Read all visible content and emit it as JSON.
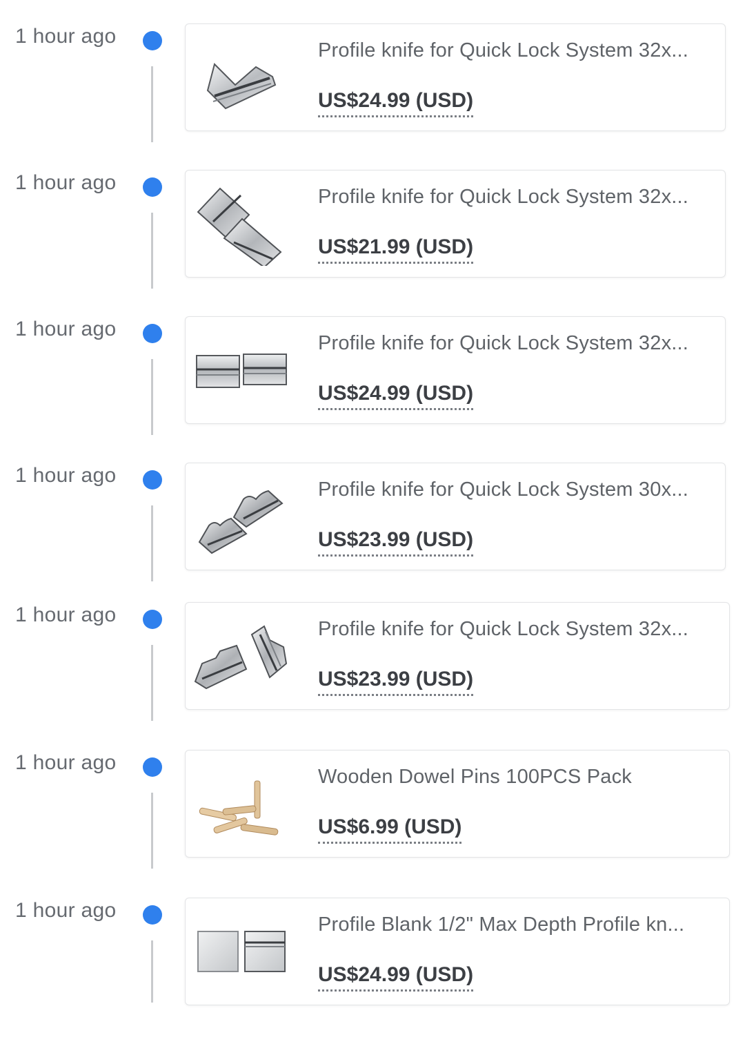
{
  "colors": {
    "accent_dot": "#2f80ed",
    "timeline_line": "#c8cacd",
    "card_border": "#e3e4e6",
    "muted_text": "#666a70",
    "price_text": "#3c3f44"
  },
  "items": [
    {
      "time": "1 hour ago",
      "title": "Profile knife for Quick Lock System 32x...",
      "price": "US$24.99 (USD)",
      "icon": "profile-knife-single-icon"
    },
    {
      "time": "1 hour ago",
      "title": "Profile knife for Quick Lock System 32x...",
      "price": "US$21.99 (USD)",
      "icon": "profile-knife-pair-diagonal-icon"
    },
    {
      "time": "1 hour ago",
      "title": "Profile knife for Quick Lock System 32x...",
      "price": "US$24.99 (USD)",
      "icon": "profile-knife-pair-flat-icon"
    },
    {
      "time": "1 hour ago",
      "title": "Profile knife for Quick Lock System 30x...",
      "price": "US$23.99 (USD)",
      "icon": "profile-knife-notched-icon"
    },
    {
      "time": "1 hour ago",
      "title": "Profile knife for Quick Lock System 32x...",
      "price": "US$23.99 (USD)",
      "icon": "profile-knife-stepped-icon"
    },
    {
      "time": "1 hour ago",
      "title": "Wooden Dowel Pins 100PCS Pack",
      "price": "US$6.99 (USD)",
      "icon": "wooden-dowel-pins-icon"
    },
    {
      "time": "1 hour ago",
      "title": "Profile Blank 1/2\" Max Depth Profile kn...",
      "price": "US$24.99 (USD)",
      "icon": "profile-blank-icon"
    }
  ]
}
